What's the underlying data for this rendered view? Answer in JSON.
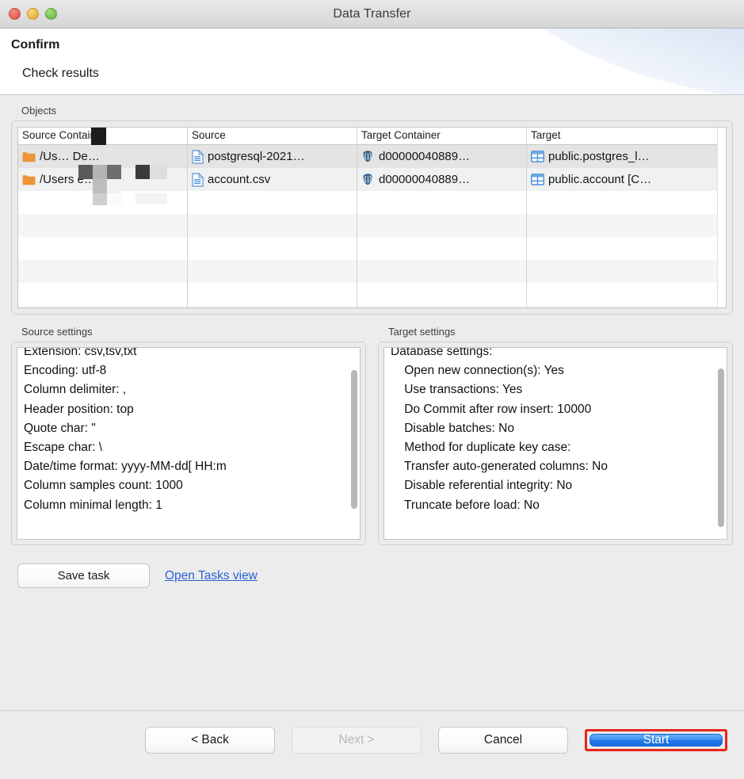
{
  "window": {
    "title": "Data Transfer",
    "traffic_lights": [
      "close-red",
      "minimize-yellow",
      "maximize-green"
    ]
  },
  "header": {
    "title": "Confirm",
    "subtitle": "Check results"
  },
  "objects": {
    "group_label": "Objects",
    "columns": [
      "Source Container",
      "Source",
      "Target Container",
      "Target"
    ],
    "rows": [
      {
        "source_container": "/Us…     De…",
        "source": "postgresql-2021…",
        "target_container": "d00000040889…",
        "target": "public.postgres_l…",
        "icons": [
          "folder-icon",
          "csv-file-icon",
          "postgresql-database-icon",
          "database-table-icon"
        ],
        "selected": true
      },
      {
        "source_container": "/Users        e…",
        "source": "account.csv",
        "target_container": "d00000040889…",
        "target": "public.account [C…",
        "icons": [
          "folder-icon",
          "csv-file-icon",
          "postgresql-database-icon",
          "database-table-icon"
        ],
        "selected": false
      }
    ],
    "empty_row_count": 6
  },
  "source_settings": {
    "group_label": "Source settings",
    "lines": [
      "Extension: csv,tsv,txt",
      "Encoding: utf-8",
      "Column delimiter: ,",
      "Header position: top",
      "Quote char: \"",
      "Escape char: \\",
      "Date/time format: yyyy-MM-dd[ HH:m",
      "Column samples count: 1000",
      "Column minimal length: 1"
    ]
  },
  "target_settings": {
    "group_label": "Target settings",
    "lines": [
      "Database settings:",
      "    Open new connection(s): Yes",
      "    Use transactions: Yes",
      "    Do Commit after row insert: 10000",
      "    Disable batches: No",
      "    Method for duplicate key case:",
      "    Transfer auto-generated columns: No",
      "    Disable referential integrity: No",
      "    Truncate before load: No"
    ]
  },
  "task_row": {
    "save_task_label": "Save task",
    "open_tasks_label": "Open Tasks view"
  },
  "footer": {
    "back_label": "< Back",
    "next_label": "Next >",
    "next_disabled": true,
    "cancel_label": "Cancel",
    "start_label": "Start",
    "start_highlight_color": "#e8241c",
    "start_button_color": "#2a80ec"
  }
}
